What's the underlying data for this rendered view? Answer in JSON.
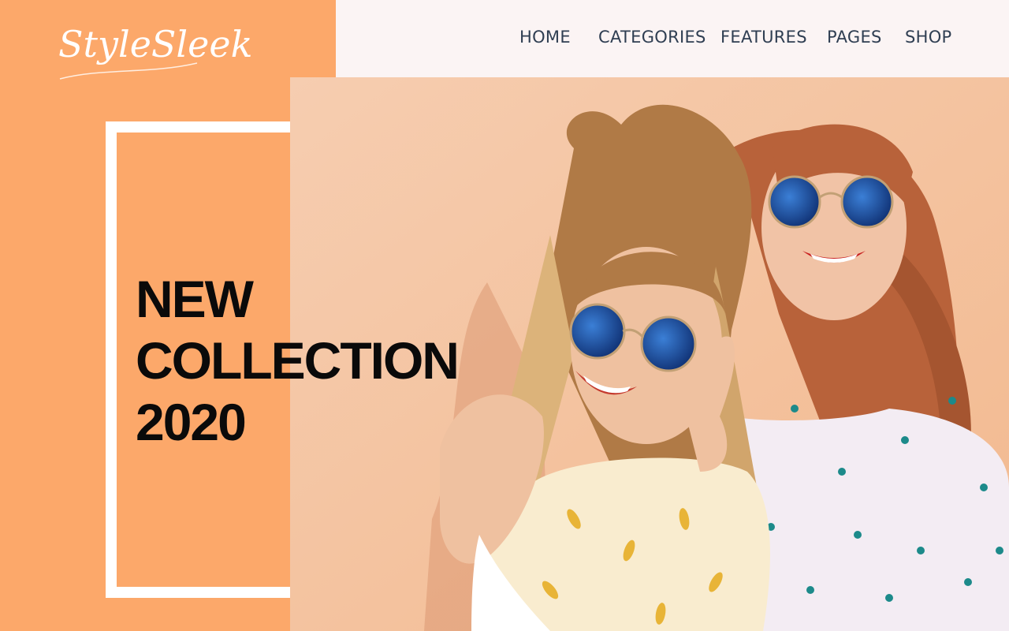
{
  "brand": {
    "logo_text": "StyleSleek"
  },
  "nav": {
    "items": [
      {
        "label": "HOME"
      },
      {
        "label": "CATEGORIES"
      },
      {
        "label": "FEATURES"
      },
      {
        "label": "PAGES"
      },
      {
        "label": "SHOP"
      }
    ]
  },
  "hero": {
    "headline_line1": "NEW",
    "headline_line2": "COLLECTION",
    "headline_line3": "2020"
  },
  "colors": {
    "accent_orange": "#fca86a",
    "nav_background": "#fbf4f4",
    "nav_text": "#2f3e52",
    "headline_text": "#0a0a0a",
    "hero_background": "#f7c9a4"
  }
}
